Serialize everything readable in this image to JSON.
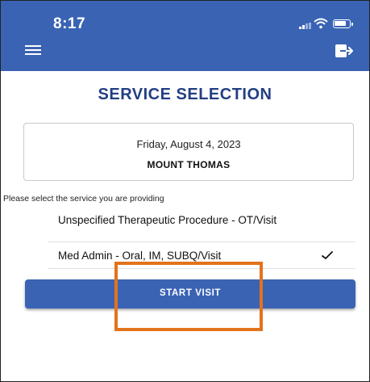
{
  "status_bar": {
    "time": "8:17",
    "icons": [
      "signal-icon",
      "wifi-icon",
      "battery-icon"
    ]
  },
  "app_bar": {
    "background_color": "#3a63b4",
    "left_icon": "menu-icon",
    "right_icon": "logout-icon"
  },
  "page": {
    "title": "SERVICE SELECTION",
    "title_color": "#233f83"
  },
  "visit_info": {
    "date": "Friday, August 4, 2023",
    "location": "MOUNT THOMAS"
  },
  "service_prompt": "Please select the service you are providing",
  "services": [
    {
      "label": "Unspecified Therapeutic Procedure - OT/Visit",
      "selected": false
    },
    {
      "label": "Med Admin - Oral, IM, SUBQ/Visit",
      "selected": true,
      "selected_icon": "checkmark-icon"
    }
  ],
  "actions": {
    "start_visit_label": "START VISIT",
    "button_color": "#3a63b4"
  },
  "annotation": {
    "highlight_color": "#e3731b"
  }
}
